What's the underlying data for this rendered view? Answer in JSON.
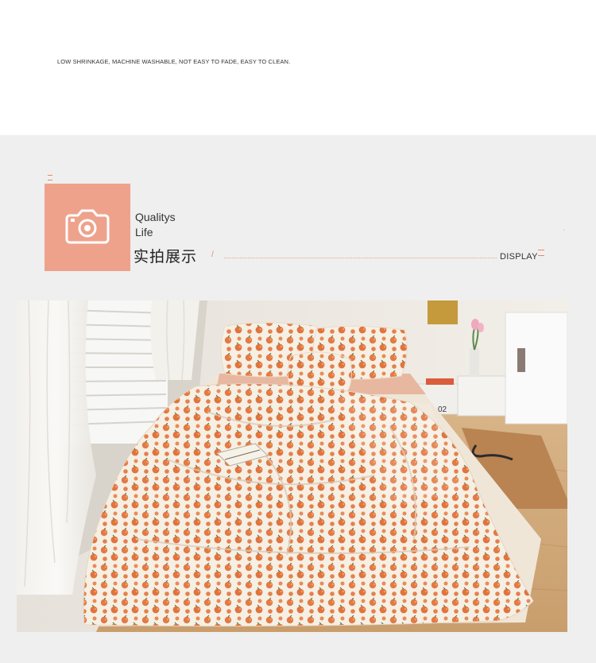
{
  "header": {
    "tagline": "LOW SHRINKAGE, MACHINE WASHABLE, NOT EASY TO FADE, EASY TO CLEAN."
  },
  "section": {
    "badge_icon": "camera-icon",
    "title_en_line1": "Qualitys",
    "title_en_line2": "Life",
    "title_cn": "实拍展示",
    "slash": "/",
    "display_label": "DISPLAY",
    "accent_color": "#eea28c"
  },
  "photo": {
    "box_label": "02"
  }
}
